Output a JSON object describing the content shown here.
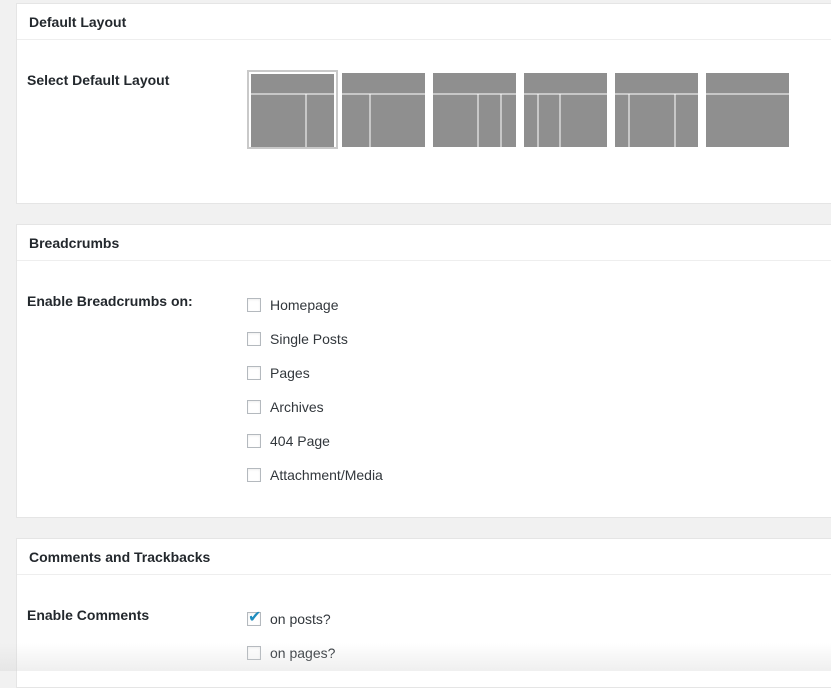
{
  "layout_section": {
    "title": "Default Layout",
    "row_label": "Select Default Layout",
    "options": [
      {
        "name": "content-sidebar-sidebar",
        "selected": true
      },
      {
        "name": "sidebar-sidebar-content",
        "selected": false
      },
      {
        "name": "content-sidebar-sidebar-narrow",
        "selected": false
      },
      {
        "name": "sidebar-content-sidebar",
        "selected": false
      },
      {
        "name": "sidebar-content-sidebar-2",
        "selected": false
      },
      {
        "name": "full-width-content",
        "selected": false
      }
    ]
  },
  "breadcrumbs_section": {
    "title": "Breadcrumbs",
    "row_label": "Enable Breadcrumbs on:",
    "options": [
      {
        "label": "Homepage",
        "checked": false
      },
      {
        "label": "Single Posts",
        "checked": false
      },
      {
        "label": "Pages",
        "checked": false
      },
      {
        "label": "Archives",
        "checked": false
      },
      {
        "label": "404 Page",
        "checked": false
      },
      {
        "label": "Attachment/Media",
        "checked": false
      }
    ]
  },
  "comments_section": {
    "title": "Comments and Trackbacks",
    "row_label": "Enable Comments",
    "options": [
      {
        "label": "on posts?",
        "checked": true
      },
      {
        "label": "on pages?",
        "checked": false
      }
    ]
  },
  "colors": {
    "layout_block": "#8f8f8f",
    "checkbox_check": "#1e8cbe",
    "selected_border": "#c9c9c9"
  }
}
